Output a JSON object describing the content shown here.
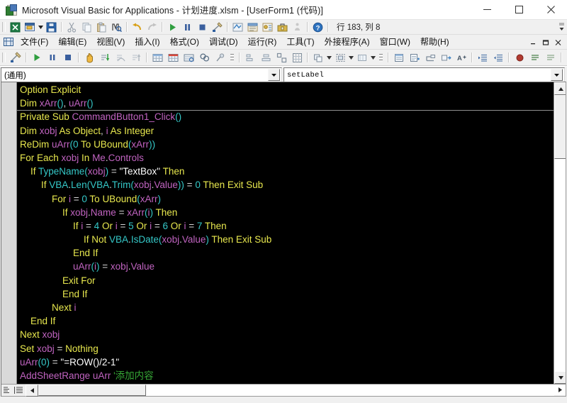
{
  "window": {
    "title": "Microsoft Visual Basic for Applications - 计划进度.xlsm - [UserForm1 (代码)]",
    "app_icon": "vba-excel-icon",
    "minimize_label": "—",
    "maximize_label": "▢",
    "close_label": "✕"
  },
  "menubar": {
    "icon": "vbaproject-icon",
    "items": [
      {
        "label": "文件(F)",
        "accel": "F"
      },
      {
        "label": "编辑(E)",
        "accel": "E"
      },
      {
        "label": "视图(V)",
        "accel": "V"
      },
      {
        "label": "插入(I)",
        "accel": "I"
      },
      {
        "label": "格式(O)",
        "accel": "O"
      },
      {
        "label": "调试(D)",
        "accel": "D"
      },
      {
        "label": "运行(R)",
        "accel": "R"
      },
      {
        "label": "工具(T)",
        "accel": "T"
      },
      {
        "label": "外接程序(A)",
        "accel": "A"
      },
      {
        "label": "窗口(W)",
        "accel": "W"
      },
      {
        "label": "帮助(H)",
        "accel": "H"
      }
    ],
    "win_minimize": "_",
    "win_restore": "❐",
    "win_close": "✕"
  },
  "toolbar_standard": {
    "position_label": "行 183, 列 8",
    "buttons": [
      {
        "name": "view-excel-icon",
        "tip": "视图 Microsoft Excel"
      },
      {
        "name": "insert-userform-icon",
        "tip": "插入 UserForm"
      },
      {
        "name": "insert-dropdown-icon",
        "tip": "插入下拉"
      },
      {
        "name": "save-icon",
        "tip": "保存"
      },
      {
        "name": "cut-icon",
        "tip": "剪切"
      },
      {
        "name": "copy-icon",
        "tip": "复制"
      },
      {
        "name": "paste-icon",
        "tip": "粘贴"
      },
      {
        "name": "find-icon",
        "tip": "查找"
      },
      {
        "name": "undo-icon",
        "tip": "撤消"
      },
      {
        "name": "redo-icon",
        "tip": "恢复"
      },
      {
        "name": "run-icon",
        "tip": "运行子过程/用户窗体"
      },
      {
        "name": "pause-icon",
        "tip": "中断"
      },
      {
        "name": "stop-icon",
        "tip": "重新设置"
      },
      {
        "name": "design-mode-icon",
        "tip": "设计模式"
      },
      {
        "name": "project-explorer-icon",
        "tip": "工程资源管理器"
      },
      {
        "name": "properties-window-icon",
        "tip": "属性窗口"
      },
      {
        "name": "object-browser-icon",
        "tip": "对象浏览器"
      },
      {
        "name": "toolbox-icon",
        "tip": "工具箱"
      },
      {
        "name": "help-icon",
        "tip": "帮助"
      }
    ],
    "overflow": "toolbar-overflow-icon"
  },
  "toolbar_edit": {
    "buttons": [
      {
        "name": "design-mode-icon"
      },
      {
        "name": "run-icon"
      },
      {
        "name": "break-icon"
      },
      {
        "name": "reset-icon"
      },
      {
        "name": "hand-icon"
      },
      {
        "name": "step-into-icon"
      },
      {
        "name": "step-over-icon"
      },
      {
        "name": "step-out-icon"
      },
      {
        "name": "locals-window-icon"
      },
      {
        "name": "immediate-window-icon"
      },
      {
        "name": "watch-window-icon"
      },
      {
        "name": "quick-watch-icon"
      },
      {
        "name": "call-stack-icon"
      },
      {
        "name": "align-left-icon"
      },
      {
        "name": "align-center-icon"
      },
      {
        "name": "make-same-size-icon"
      },
      {
        "name": "size-to-grid-icon"
      },
      {
        "name": "zorder-icon"
      },
      {
        "name": "group-icon"
      },
      {
        "name": "arrange-icon"
      },
      {
        "name": "list-properties-icon"
      },
      {
        "name": "list-constants-icon"
      },
      {
        "name": "quick-info-icon"
      },
      {
        "name": "parameter-info-icon"
      },
      {
        "name": "complete-word-icon"
      },
      {
        "name": "indent-icon"
      },
      {
        "name": "outdent-icon"
      },
      {
        "name": "toggle-breakpoint-icon"
      },
      {
        "name": "comment-block-icon"
      },
      {
        "name": "uncomment-block-icon"
      },
      {
        "name": "toggle-bookmark-icon"
      },
      {
        "name": "next-bookmark-icon"
      },
      {
        "name": "previous-bookmark-icon"
      },
      {
        "name": "clear-bookmarks-icon"
      }
    ]
  },
  "code_window": {
    "object_combo": {
      "value": "(通用)",
      "name": "object-dropdown"
    },
    "procedure_combo": {
      "value": "setLabel",
      "name": "procedure-dropdown"
    },
    "colors": {
      "background": "#000000",
      "keyword": "#e8e84e",
      "identifier": "#c063c0",
      "builtin": "#35c8c8",
      "number": "#35c8c8",
      "string": "#ffffff",
      "comment": "#36a836",
      "operator": "#d8d8d8",
      "punctuation": "#35c8c8",
      "margin": "#d9d9d9"
    },
    "lines": [
      [
        [
          "Option Explicit",
          "keyword"
        ]
      ],
      [
        [
          "Dim ",
          "keyword"
        ],
        [
          "xArr",
          "identifier"
        ],
        [
          "()",
          "punctuation"
        ],
        [
          ", ",
          "operator"
        ],
        [
          "uArr",
          "identifier"
        ],
        [
          "()",
          "punctuation"
        ]
      ],
      [
        [
          "Private Sub ",
          "keyword"
        ],
        [
          "CommandButton1_Click",
          "identifier"
        ],
        [
          "()",
          "punctuation"
        ]
      ],
      [
        [
          "Dim ",
          "keyword"
        ],
        [
          "xobj",
          "identifier"
        ],
        [
          " As Object",
          "keyword"
        ],
        [
          ", ",
          "operator"
        ],
        [
          "i",
          "identifier"
        ],
        [
          " As Integer",
          "keyword"
        ]
      ],
      [
        [
          "ReDim ",
          "keyword"
        ],
        [
          "uArr",
          "identifier"
        ],
        [
          "(",
          "punctuation"
        ],
        [
          "0",
          "number"
        ],
        [
          " To ",
          "keyword"
        ],
        [
          "UBound",
          "keyword"
        ],
        [
          "(",
          "punctuation"
        ],
        [
          "xArr",
          "identifier"
        ],
        [
          "))",
          "punctuation"
        ]
      ],
      [
        [
          "For Each ",
          "keyword"
        ],
        [
          "xobj",
          "identifier"
        ],
        [
          " In ",
          "keyword"
        ],
        [
          "Me",
          "identifier"
        ],
        [
          ".",
          "operator"
        ],
        [
          "Controls",
          "identifier"
        ]
      ],
      [
        [
          "    If ",
          "keyword"
        ],
        [
          "TypeName",
          "builtin"
        ],
        [
          "(",
          "punctuation"
        ],
        [
          "xobj",
          "identifier"
        ],
        [
          ")",
          "punctuation"
        ],
        [
          " = ",
          "operator"
        ],
        [
          "\"TextBox\"",
          "string"
        ],
        [
          " Then",
          "keyword"
        ]
      ],
      [
        [
          "        If ",
          "keyword"
        ],
        [
          "VBA",
          "builtin"
        ],
        [
          ".",
          "operator"
        ],
        [
          "Len",
          "builtin"
        ],
        [
          "(",
          "punctuation"
        ],
        [
          "VBA",
          "builtin"
        ],
        [
          ".",
          "operator"
        ],
        [
          "Trim",
          "builtin"
        ],
        [
          "(",
          "punctuation"
        ],
        [
          "xobj",
          "identifier"
        ],
        [
          ".",
          "operator"
        ],
        [
          "Value",
          "identifier"
        ],
        [
          "))",
          "punctuation"
        ],
        [
          " = ",
          "operator"
        ],
        [
          "0",
          "number"
        ],
        [
          " Then Exit Sub",
          "keyword"
        ]
      ],
      [
        [
          "            For ",
          "keyword"
        ],
        [
          "i",
          "identifier"
        ],
        [
          " = ",
          "operator"
        ],
        [
          "0",
          "number"
        ],
        [
          " To ",
          "keyword"
        ],
        [
          "UBound",
          "keyword"
        ],
        [
          "(",
          "punctuation"
        ],
        [
          "xArr",
          "identifier"
        ],
        [
          ")",
          "punctuation"
        ]
      ],
      [
        [
          "                If ",
          "keyword"
        ],
        [
          "xobj",
          "identifier"
        ],
        [
          ".",
          "operator"
        ],
        [
          "Name",
          "identifier"
        ],
        [
          " = ",
          "operator"
        ],
        [
          "xArr",
          "identifier"
        ],
        [
          "(",
          "punctuation"
        ],
        [
          "i",
          "identifier"
        ],
        [
          ")",
          "punctuation"
        ],
        [
          " Then",
          "keyword"
        ]
      ],
      [
        [
          "                    If ",
          "keyword"
        ],
        [
          "i",
          "identifier"
        ],
        [
          " = ",
          "operator"
        ],
        [
          "4",
          "number"
        ],
        [
          " Or ",
          "keyword"
        ],
        [
          "i",
          "identifier"
        ],
        [
          " = ",
          "operator"
        ],
        [
          "5",
          "number"
        ],
        [
          " Or ",
          "keyword"
        ],
        [
          "i",
          "identifier"
        ],
        [
          " = ",
          "operator"
        ],
        [
          "6",
          "number"
        ],
        [
          " Or ",
          "keyword"
        ],
        [
          "i",
          "identifier"
        ],
        [
          " = ",
          "operator"
        ],
        [
          "7",
          "number"
        ],
        [
          " Then",
          "keyword"
        ]
      ],
      [
        [
          "                        If Not ",
          "keyword"
        ],
        [
          "VBA",
          "builtin"
        ],
        [
          ".",
          "operator"
        ],
        [
          "IsDate",
          "builtin"
        ],
        [
          "(",
          "punctuation"
        ],
        [
          "xobj",
          "identifier"
        ],
        [
          ".",
          "operator"
        ],
        [
          "Value",
          "identifier"
        ],
        [
          ")",
          "punctuation"
        ],
        [
          " Then Exit Sub",
          "keyword"
        ]
      ],
      [
        [
          "                    End If",
          "keyword"
        ]
      ],
      [
        [
          "                    ",
          "keyword"
        ],
        [
          "uArr",
          "identifier"
        ],
        [
          "(",
          "punctuation"
        ],
        [
          "i",
          "identifier"
        ],
        [
          ")",
          "punctuation"
        ],
        [
          " = ",
          "operator"
        ],
        [
          "xobj",
          "identifier"
        ],
        [
          ".",
          "operator"
        ],
        [
          "Value",
          "identifier"
        ]
      ],
      [
        [
          "                Exit For",
          "keyword"
        ]
      ],
      [
        [
          "                End If",
          "keyword"
        ]
      ],
      [
        [
          "            Next ",
          "keyword"
        ],
        [
          "i",
          "identifier"
        ]
      ],
      [
        [
          "    End If",
          "keyword"
        ]
      ],
      [
        [
          "Next ",
          "keyword"
        ],
        [
          "xobj",
          "identifier"
        ]
      ],
      [
        [
          "Set ",
          "keyword"
        ],
        [
          "xobj",
          "identifier"
        ],
        [
          " = ",
          "operator"
        ],
        [
          "Nothing",
          "keyword"
        ]
      ],
      [
        [
          "uArr",
          "identifier"
        ],
        [
          "(",
          "punctuation"
        ],
        [
          "0",
          "number"
        ],
        [
          ")",
          "punctuation"
        ],
        [
          " = ",
          "operator"
        ],
        [
          "\"=ROW()/2-1\"",
          "string"
        ]
      ],
      [
        [
          "AddSheetRange",
          "identifier"
        ],
        [
          " uArr ",
          "identifier"
        ],
        [
          "'添加内容",
          "comment"
        ]
      ]
    ],
    "scroll": {
      "vertical_up": "scroll-up-arrow",
      "vertical_down": "scroll-down-arrow",
      "horizontal_left": "scroll-left-arrow",
      "horizontal_right": "scroll-right-arrow",
      "proc_view": "procedure-view-icon",
      "full_view": "full-module-view-icon"
    }
  }
}
